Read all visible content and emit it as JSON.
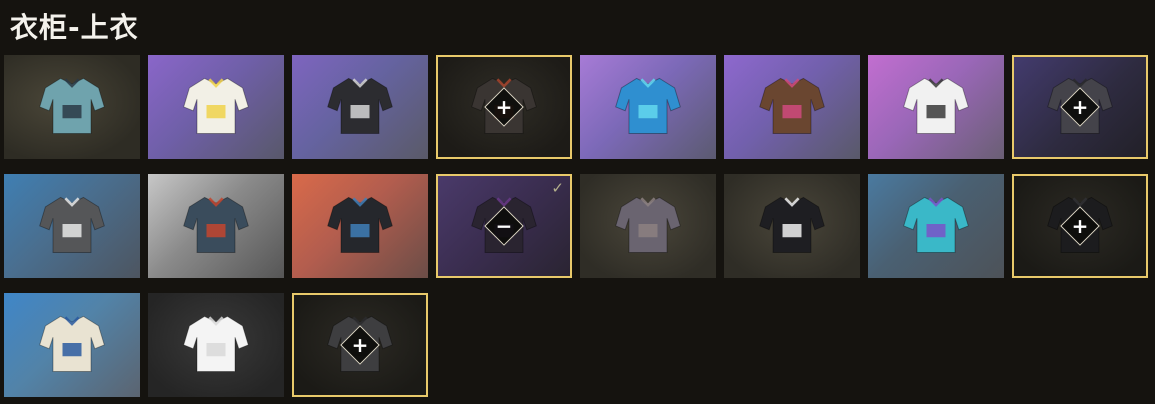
{
  "page": {
    "title": "衣柜-上衣"
  },
  "items": [
    {
      "art": "floral-hawaiian-shirt",
      "selected": false,
      "badge": "",
      "checked": false,
      "bg": "radial-gradient(ellipse at 40% 45%, #4a4638 0%, #2e2c24 75%)",
      "c1": "#6fa3ad",
      "c2": "#2c3a45"
    },
    {
      "art": "white-tshirt-with-chick-print",
      "selected": false,
      "badge": "",
      "checked": false,
      "bg": "linear-gradient(135deg, #8a66c9 0%, #6f5fa8 45%, #58586a 100%)",
      "c1": "#f2f0e6",
      "c2": "#f0d24a"
    },
    {
      "art": "black-sport-tshirt",
      "selected": false,
      "badge": "",
      "checked": false,
      "bg": "linear-gradient(135deg, #7e64bf 0%, #6563a0 45%, #5a5a68 100%)",
      "c1": "#2c2c30",
      "c2": "#d6d6d6"
    },
    {
      "art": "black-leather-jacket",
      "selected": true,
      "badge": "+",
      "checked": false,
      "bg": "radial-gradient(ellipse at 50% 45%, #2f2d26 0%, #1d1b17 80%)",
      "c1": "#3a3532",
      "c2": "#a8452e"
    },
    {
      "art": "neon-blue-jacket",
      "selected": false,
      "badge": "",
      "checked": false,
      "bg": "linear-gradient(135deg, #a77bd6 0%, #7c69b8 45%, #5b5a70 100%)",
      "c1": "#2f8fd0",
      "c2": "#63d8ef"
    },
    {
      "art": "brown-fur-costume",
      "selected": false,
      "badge": "",
      "checked": false,
      "bg": "linear-gradient(135deg, #8e68ce 0%, #7260ad 45%, #595969 100%)",
      "c1": "#6a4630",
      "c2": "#d04a7e"
    },
    {
      "art": "white-sports-bra",
      "selected": false,
      "badge": "",
      "checked": false,
      "bg": "linear-gradient(135deg, #c26ed0 0%, #9a67b8 45%, #6a5f74 100%)",
      "c1": "#f1f1f1",
      "c2": "#3a3a3a"
    },
    {
      "art": "dark-grey-sweater",
      "selected": true,
      "badge": "+",
      "checked": false,
      "bg": "linear-gradient(135deg, #433b6e 0%, #2e2b40 55%, #222028 100%)",
      "c1": "#44434a",
      "c2": "#2a2a2e"
    },
    {
      "art": "grey-blazer",
      "selected": false,
      "badge": "",
      "checked": false,
      "bg": "linear-gradient(135deg, #3f7fb3 0%, #4a6e8e 45%, #4d5560 100%)",
      "c1": "#555658",
      "c2": "#e8e8e8"
    },
    {
      "art": "red-graphic-tshirt",
      "selected": false,
      "badge": "",
      "checked": false,
      "bg": "linear-gradient(135deg, #c7c7c7 0%, #8a8a8a 45%, #565656 100%)",
      "c1": "#3a4c5c",
      "c2": "#c4452e"
    },
    {
      "art": "black-hooded-jacket",
      "selected": false,
      "badge": "",
      "checked": false,
      "bg": "linear-gradient(135deg, #d96a4a 0%, #b25d4e 45%, #6b4d47 100%)",
      "c1": "#25272c",
      "c2": "#3f7fb8"
    },
    {
      "art": "dark-sleeves-item",
      "selected": true,
      "badge": "−",
      "checked": true,
      "bg": "linear-gradient(135deg, #4a3a6a 0%, #3a2d4f 50%, #2a2432 100%)",
      "c1": "#2a2430",
      "c2": "#6a3a8a"
    },
    {
      "art": "plaid-flannel-shirt",
      "selected": false,
      "badge": "",
      "checked": false,
      "bg": "radial-gradient(ellipse at 50% 45%, #4a463a 0%, #2f2d26 80%)",
      "c1": "#6a6470",
      "c2": "#8c8080"
    },
    {
      "art": "black-hoodie",
      "selected": false,
      "badge": "",
      "checked": false,
      "bg": "radial-gradient(ellipse at 50% 45%, #4a463a 0%, #2f2d26 80%)",
      "c1": "#1e1e22",
      "c2": "#f0f0f0"
    },
    {
      "art": "blue-bunny-hoodie",
      "selected": false,
      "badge": "",
      "checked": false,
      "bg": "linear-gradient(135deg, #4a7aa0 0%, #4a6072 45%, #4d5258 100%)",
      "c1": "#3ab8c8",
      "c2": "#7a52c8"
    },
    {
      "art": "black-suit-item",
      "selected": true,
      "badge": "+",
      "checked": false,
      "bg": "radial-gradient(ellipse at 50% 45%, #2c2a24 0%, #1b1a16 80%)",
      "c1": "#1c1c1e",
      "c2": "#303034"
    },
    {
      "art": "nautical-print-scarf",
      "selected": false,
      "badge": "",
      "checked": false,
      "bg": "linear-gradient(135deg, #3f86c8 0%, #5283a8 45%, #5b6470 100%)",
      "c1": "#e9e3d2",
      "c2": "#2a5aa0"
    },
    {
      "art": "plain-white-tshirt",
      "selected": false,
      "badge": "",
      "checked": false,
      "bg": "radial-gradient(ellipse at 50% 45%, #3a3a3a 0%, #252525 80%)",
      "c1": "#f4f4f4",
      "c2": "#d8d8d8"
    },
    {
      "art": "dark-grey-tshirt",
      "selected": true,
      "badge": "+",
      "checked": false,
      "bg": "radial-gradient(ellipse at 50% 45%, #2c2a24 0%, #1b1a16 80%)",
      "c1": "#3e3e40",
      "c2": "#2c2c2e"
    }
  ]
}
